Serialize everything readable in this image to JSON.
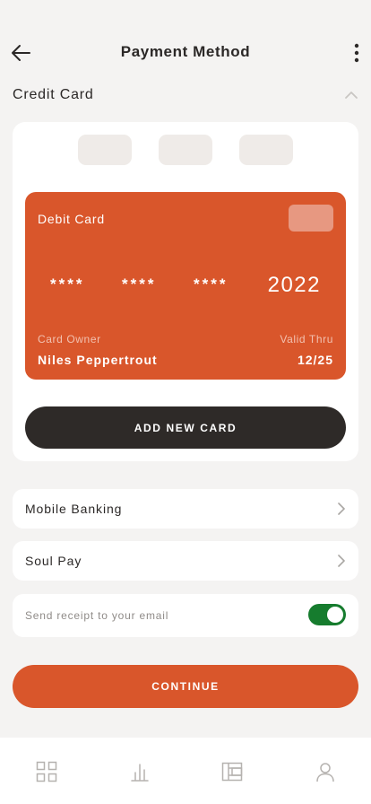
{
  "header": {
    "title": "Payment Method",
    "back_icon": "arrow-left-icon",
    "more_icon": "more-vertical-icon"
  },
  "credit_section": {
    "title": "Credit Card",
    "collapse_icon": "chevron-up-icon",
    "card_tabs": [
      "",
      "",
      ""
    ],
    "card": {
      "type_label": "Debit Card",
      "number_groups": [
        "****",
        "****",
        "****"
      ],
      "last_group": "2022",
      "owner_label": "Card Owner",
      "owner_name": "Niles Peppertrout",
      "valid_label": "Valid Thru",
      "valid_date": "12/25",
      "color": "#d9562b"
    },
    "add_button": "ADD NEW CARD"
  },
  "options": [
    {
      "label": "Mobile Banking",
      "icon": "chevron-right-icon"
    },
    {
      "label": "Soul Pay",
      "icon": "chevron-right-icon"
    }
  ],
  "receipt": {
    "label": "Send receipt to your email",
    "enabled": true
  },
  "continue_button": "CONTINUE",
  "bottom_nav": [
    {
      "icon": "grid-icon"
    },
    {
      "icon": "bar-chart-icon"
    },
    {
      "icon": "wallet-icon"
    },
    {
      "icon": "user-icon"
    }
  ],
  "colors": {
    "accent": "#d9562b",
    "dark": "#2e2a28",
    "toggle_on": "#167c2e",
    "background": "#f4f3f2"
  }
}
